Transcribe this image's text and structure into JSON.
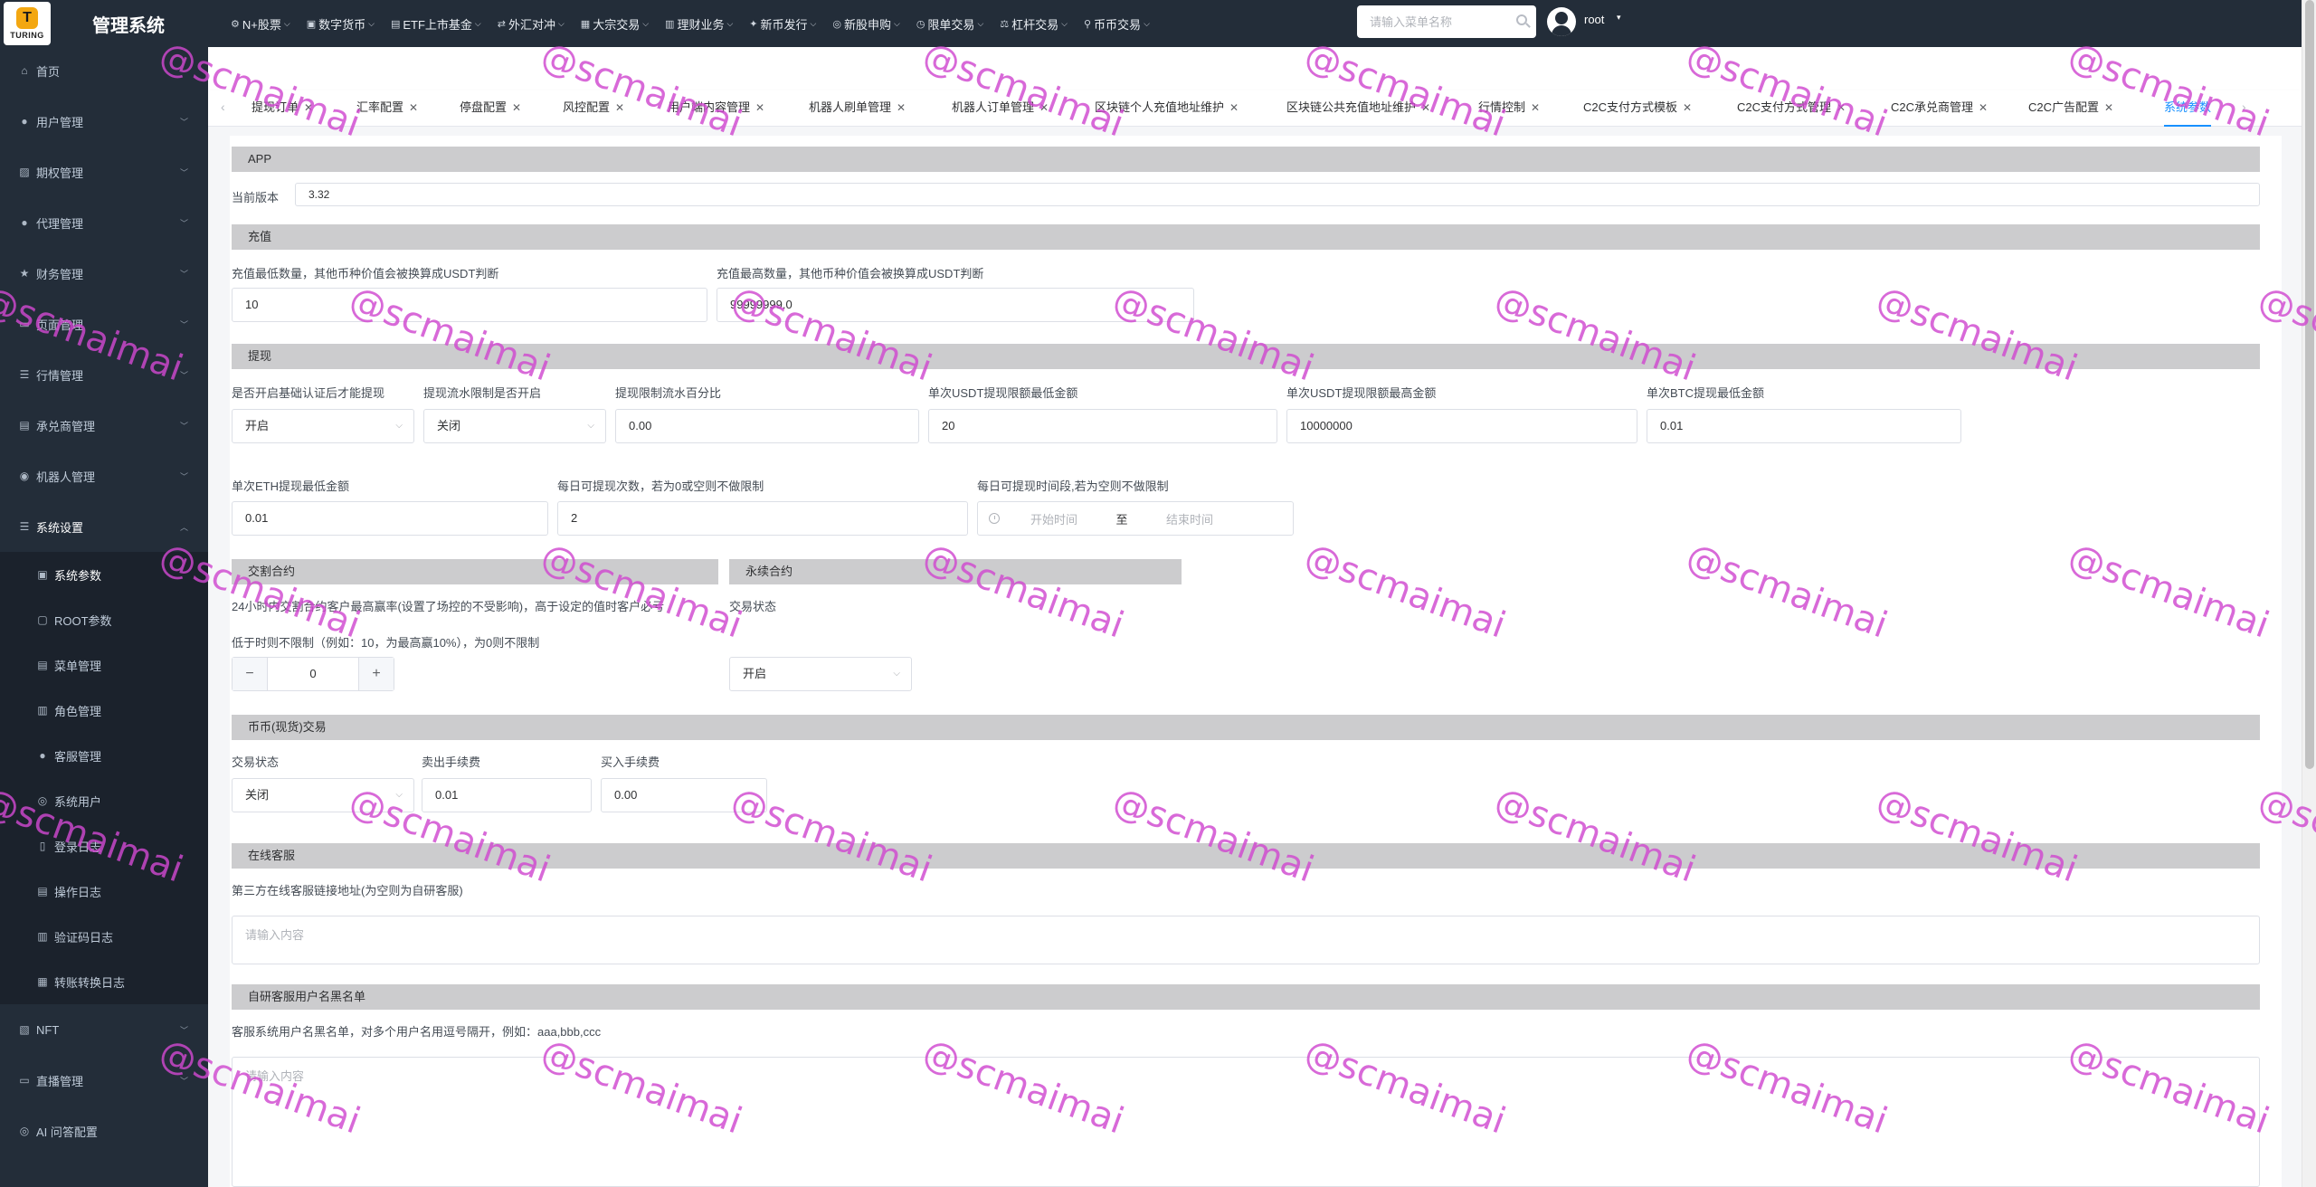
{
  "app": {
    "logo_text": "TURING",
    "title": "管理系统"
  },
  "topnav": [
    {
      "icon": "stock-icon",
      "label": "N+股票"
    },
    {
      "icon": "coin-icon",
      "label": "数字货币"
    },
    {
      "icon": "etf-icon",
      "label": "ETF上市基金"
    },
    {
      "icon": "forex-icon",
      "label": "外汇对冲"
    },
    {
      "icon": "block-trade-icon",
      "label": "大宗交易"
    },
    {
      "icon": "finance-icon",
      "label": "理财业务"
    },
    {
      "icon": "new-coin-icon",
      "label": "新币发行"
    },
    {
      "icon": "ipo-icon",
      "label": "新股申购"
    },
    {
      "icon": "clock-icon",
      "label": "限单交易"
    },
    {
      "icon": "lever-icon",
      "label": "杠杆交易"
    },
    {
      "icon": "location-icon",
      "label": "币币交易"
    }
  ],
  "search": {
    "placeholder": "请输入菜单名称"
  },
  "user": {
    "name": "root"
  },
  "sidebar": {
    "items": [
      {
        "icon": "home-icon",
        "label": "首页",
        "expandable": false
      },
      {
        "icon": "user-icon",
        "label": "用户管理",
        "expandable": true
      },
      {
        "icon": "options-icon",
        "label": "期权管理",
        "expandable": true
      },
      {
        "icon": "agent-icon",
        "label": "代理管理",
        "expandable": true
      },
      {
        "icon": "star-icon",
        "label": "财务管理",
        "expandable": true
      },
      {
        "icon": "page-icon",
        "label": "页面管理",
        "expandable": true
      },
      {
        "icon": "list-icon",
        "label": "行情管理",
        "expandable": true
      },
      {
        "icon": "merchant-icon",
        "label": "承兑商管理",
        "expandable": true
      },
      {
        "icon": "robot-icon",
        "label": "机器人管理",
        "expandable": true
      },
      {
        "icon": "settings-icon",
        "label": "系统设置",
        "expandable": true
      }
    ],
    "sub_items": [
      {
        "icon": "params-icon",
        "label": "系统参数"
      },
      {
        "icon": "root-icon",
        "label": "ROOT参数"
      },
      {
        "icon": "menu-icon",
        "label": "菜单管理"
      },
      {
        "icon": "role-icon",
        "label": "角色管理"
      },
      {
        "icon": "service-icon",
        "label": "客服管理"
      },
      {
        "icon": "system-user-icon",
        "label": "系统用户"
      },
      {
        "icon": "login-log-icon",
        "label": "登录日志"
      },
      {
        "icon": "operation-log-icon",
        "label": "操作日志"
      },
      {
        "icon": "captcha-log-icon",
        "label": "验证码日志"
      },
      {
        "icon": "transfer-log-icon",
        "label": "转账转换日志"
      }
    ],
    "bottom_items": [
      {
        "icon": "nft-icon",
        "label": "NFT",
        "expandable": true
      },
      {
        "icon": "live-icon",
        "label": "直播管理",
        "expandable": true
      },
      {
        "icon": "ai-icon",
        "label": "AI 问答配置",
        "expandable": false
      }
    ]
  },
  "tabs": [
    {
      "label": "提现订单"
    },
    {
      "label": "汇率配置"
    },
    {
      "label": "停盘配置"
    },
    {
      "label": "风控配置"
    },
    {
      "label": "用户端内容管理"
    },
    {
      "label": "机器人刷单管理"
    },
    {
      "label": "机器人订单管理"
    },
    {
      "label": "区块链个人充值地址维护"
    },
    {
      "label": "区块链公共充值地址维护"
    },
    {
      "label": "行情控制"
    },
    {
      "label": "C2C支付方式模板"
    },
    {
      "label": "C2C支付方式管理"
    },
    {
      "label": "C2C承兑商管理"
    },
    {
      "label": "C2C广告配置"
    },
    {
      "label": "系统参数"
    }
  ],
  "form": {
    "app": {
      "section": "APP",
      "version_label": "当前版本",
      "version_value": "3.32"
    },
    "recharge": {
      "section": "充值",
      "min_label": "充值最低数量，其他币种价值会被换算成USDT判断",
      "min_value": "10",
      "max_label": "充值最高数量，其他币种价值会被换算成USDT判断",
      "max_value": "99999999.0"
    },
    "withdraw": {
      "section": "提现",
      "kyc_label": "是否开启基础认证后才能提现",
      "kyc_value": "开启",
      "flow_limit_label": "提现流水限制是否开启",
      "flow_limit_value": "关闭",
      "flow_percent_label": "提现限制流水百分比",
      "flow_percent_value": "0.00",
      "usdt_min_label": "单次USDT提现限额最低金额",
      "usdt_min_value": "20",
      "usdt_max_label": "单次USDT提现限额最高金额",
      "usdt_max_value": "10000000",
      "btc_min_label": "单次BTC提现最低金额",
      "btc_min_value": "0.01",
      "eth_min_label": "单次ETH提现最低金额",
      "eth_min_value": "0.01",
      "daily_count_label": "每日可提现次数，若为0或空则不做限制",
      "daily_count_value": "2",
      "time_range_label": "每日可提现时间段,若为空则不做限制",
      "time_start_placeholder": "开始时间",
      "time_separator": "至",
      "time_end_placeholder": "结束时间"
    },
    "delivery": {
      "section": "交割合约",
      "max_win_label": "24小时内交割合约客户最高赢率(设置了场控的不受影响)，高于设定的值时客户必亏",
      "limit_label": "低于时则不限制（例如：10，为最高赢10%），为0则不限制",
      "stepper_value": "0",
      "minus": "−",
      "plus": "+"
    },
    "perpetual": {
      "section": "永续合约",
      "status_label": "交易状态",
      "status_value": "开启"
    },
    "spot": {
      "section": "币币(现货)交易",
      "status_label": "交易状态",
      "status_value": "关闭",
      "sell_fee_label": "卖出手续费",
      "sell_fee_value": "0.01",
      "buy_fee_label": "买入手续费",
      "buy_fee_value": "0.00"
    },
    "online_service": {
      "section": "在线客服",
      "url_label": "第三方在线客服链接地址(为空则为自研客服)",
      "url_placeholder": "请输入内容"
    },
    "blacklist": {
      "section": "自研客服用户名黑名单",
      "label": "客服系统用户名黑名单，对多个用户名用逗号隔开，例如：aaa,bbb,ccc",
      "placeholder": "请输入内容"
    }
  },
  "watermark": {
    "text": "@scmaimai"
  }
}
